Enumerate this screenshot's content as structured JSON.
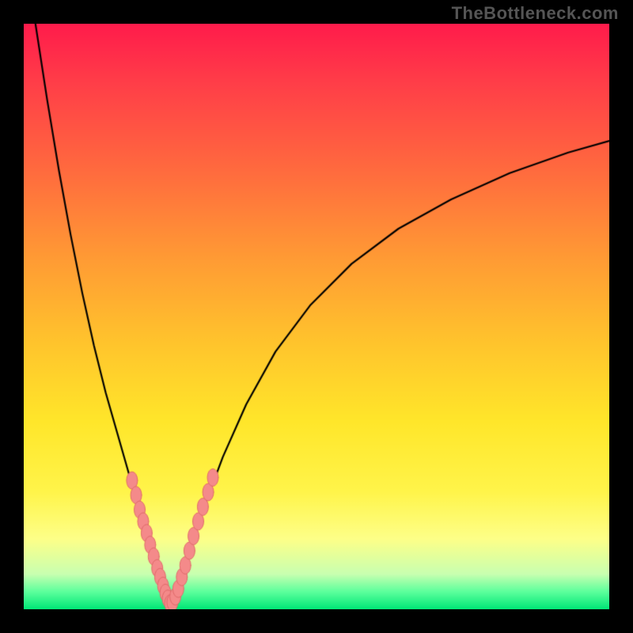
{
  "watermark": "TheBottleneck.com",
  "colors": {
    "frame_bg": "#000000",
    "curve": "#000000",
    "marker_fill": "#f48a8a",
    "marker_stroke": "#e06a6a"
  },
  "chart_data": {
    "type": "line",
    "title": "",
    "xlabel": "",
    "ylabel": "",
    "xlim": [
      0,
      100
    ],
    "ylim": [
      0,
      100
    ],
    "grid": false,
    "series": [
      {
        "name": "curve-left",
        "x": [
          2,
          4,
          6,
          8,
          10,
          12,
          14,
          16,
          18,
          19.5,
          21,
          22.2,
          23,
          23.8,
          24.5,
          25
        ],
        "y": [
          100,
          87,
          75,
          64,
          54,
          45,
          37,
          30,
          23,
          18,
          13,
          9,
          6,
          4,
          2,
          0.5
        ]
      },
      {
        "name": "curve-right",
        "x": [
          25,
          26,
          27.5,
          29,
          31,
          34,
          38,
          43,
          49,
          56,
          64,
          73,
          83,
          93,
          100
        ],
        "y": [
          0.5,
          3,
          7,
          12,
          18,
          26,
          35,
          44,
          52,
          59,
          65,
          70,
          74.5,
          78,
          80
        ]
      }
    ],
    "markers": [
      {
        "x": 18.5,
        "y": 22
      },
      {
        "x": 19.2,
        "y": 19.5
      },
      {
        "x": 19.8,
        "y": 17
      },
      {
        "x": 20.4,
        "y": 15
      },
      {
        "x": 21.0,
        "y": 13
      },
      {
        "x": 21.6,
        "y": 11
      },
      {
        "x": 22.2,
        "y": 9
      },
      {
        "x": 22.8,
        "y": 7
      },
      {
        "x": 23.3,
        "y": 5.5
      },
      {
        "x": 23.8,
        "y": 4
      },
      {
        "x": 24.2,
        "y": 2.8
      },
      {
        "x": 24.6,
        "y": 1.8
      },
      {
        "x": 25.0,
        "y": 1
      },
      {
        "x": 25.4,
        "y": 1.2
      },
      {
        "x": 25.9,
        "y": 2.2
      },
      {
        "x": 26.4,
        "y": 3.5
      },
      {
        "x": 27.0,
        "y": 5.5
      },
      {
        "x": 27.6,
        "y": 7.5
      },
      {
        "x": 28.3,
        "y": 10
      },
      {
        "x": 29.0,
        "y": 12.5
      },
      {
        "x": 29.8,
        "y": 15
      },
      {
        "x": 30.6,
        "y": 17.5
      },
      {
        "x": 31.5,
        "y": 20
      },
      {
        "x": 32.3,
        "y": 22.5
      }
    ]
  }
}
